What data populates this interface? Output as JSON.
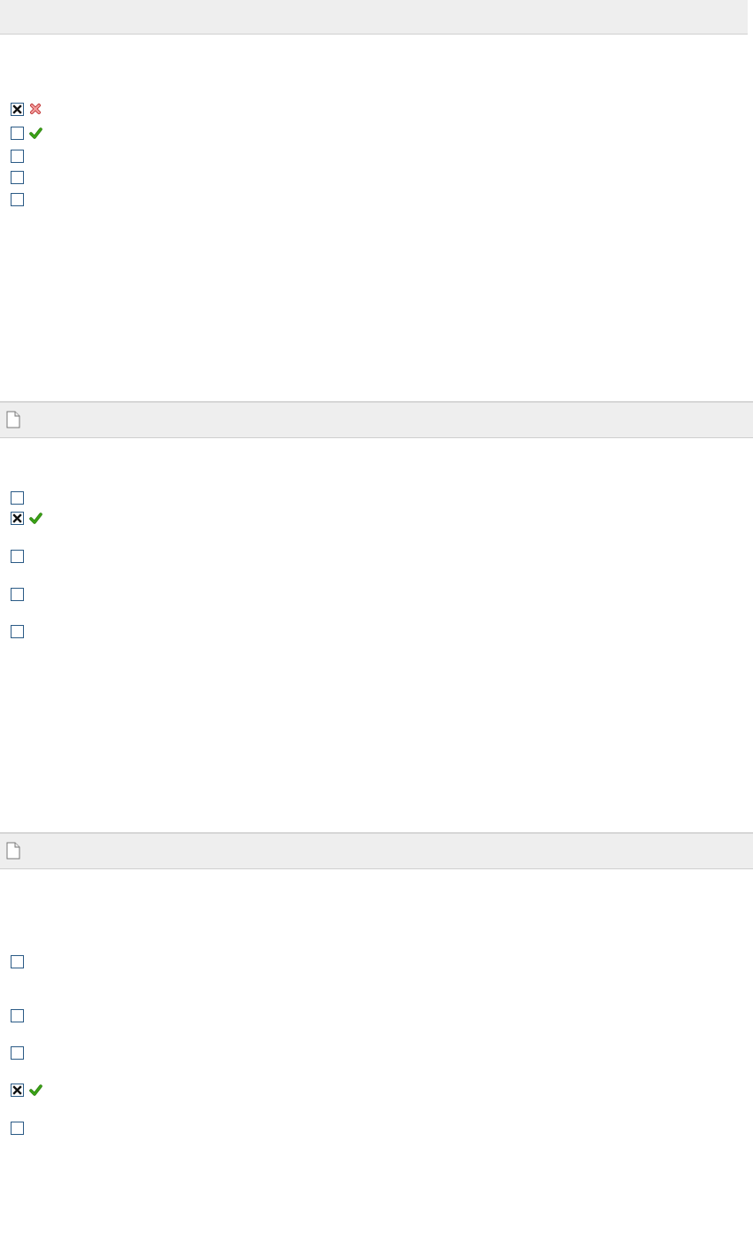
{
  "colors": {
    "bar_background": "#eeeeee",
    "checkbox_border": "#2a5a85",
    "correct_green": "#3aa316",
    "incorrect_red": "#e05050"
  },
  "sections": [
    {
      "header_icon": "document-icon",
      "options": [
        {
          "checked": true,
          "result": "incorrect"
        },
        {
          "checked": false,
          "result": "correct"
        },
        {
          "checked": false,
          "result": null
        },
        {
          "checked": false,
          "result": null
        },
        {
          "checked": false,
          "result": null
        }
      ]
    },
    {
      "header_icon": "document-icon",
      "options": [
        {
          "checked": false,
          "result": null
        },
        {
          "checked": true,
          "result": "correct"
        },
        {
          "checked": false,
          "result": null
        },
        {
          "checked": false,
          "result": null
        },
        {
          "checked": false,
          "result": null
        }
      ]
    },
    {
      "header_icon": "document-icon",
      "options": [
        {
          "checked": false,
          "result": null
        },
        {
          "checked": false,
          "result": null
        },
        {
          "checked": false,
          "result": null
        },
        {
          "checked": true,
          "result": "correct"
        },
        {
          "checked": false,
          "result": null
        }
      ]
    }
  ]
}
